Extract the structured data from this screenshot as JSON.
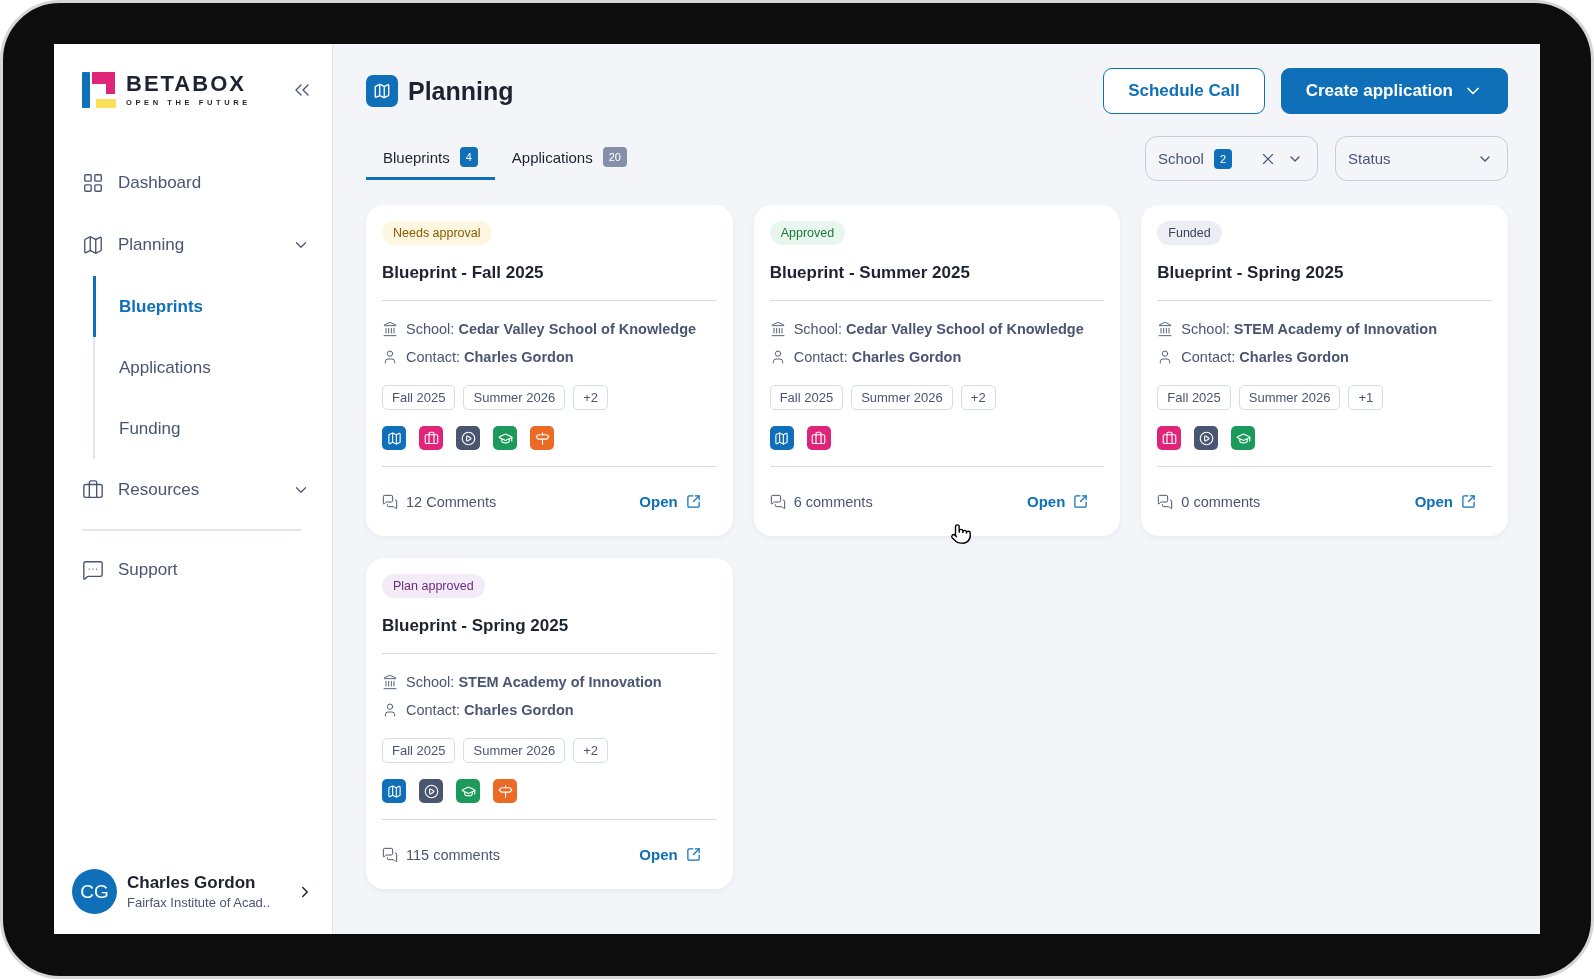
{
  "logo": {
    "name": "BETABOX",
    "tagline": "OPEN THE FUTURE"
  },
  "sidebar": {
    "items": [
      {
        "label": "Dashboard",
        "kind": "link",
        "selected": false
      },
      {
        "label": "Planning",
        "kind": "group",
        "selected": false,
        "expanded": true,
        "children": [
          {
            "label": "Blueprints",
            "selected": true
          },
          {
            "label": "Applications",
            "selected": false
          },
          {
            "label": "Funding",
            "selected": false
          }
        ]
      },
      {
        "label": "Resources",
        "kind": "group",
        "selected": false
      },
      {
        "label": "Support",
        "kind": "link",
        "selected": false
      }
    ],
    "user": {
      "initials": "CG",
      "name": "Charles Gordon",
      "org": "Fairfax Institute of Acad.."
    }
  },
  "header": {
    "title": "Planning",
    "buttons": [
      {
        "label": "Schedule Call",
        "kind": "outline"
      },
      {
        "label": "Create application",
        "kind": "primary"
      }
    ]
  },
  "tabs": [
    {
      "label": "Blueprints",
      "count": "4",
      "selected": true
    },
    {
      "label": "Applications",
      "count": "20",
      "selected": false
    }
  ],
  "filters": [
    {
      "label": "School",
      "count": "2",
      "clearable": true
    },
    {
      "label": "Status",
      "clearable": false
    }
  ],
  "cards": [
    {
      "status": {
        "label": "Needs approval",
        "kind": "warning"
      },
      "title": "Blueprint - Fall 2025",
      "school": "School: **Cedar Valley School of Knowledge**",
      "contact": "Contact: **Charles Gordon**",
      "tags": [
        "Fall 2025",
        "Summer 2026",
        "+2"
      ],
      "programs": [
        {
          "kind": "map",
          "color": "#0f6fb8"
        },
        {
          "kind": "briefcase",
          "color": "#e0247a"
        },
        {
          "kind": "play",
          "color": "#4a5572"
        },
        {
          "kind": "cap",
          "color": "#1c9a5c"
        },
        {
          "kind": "sign",
          "color": "#ea6a26"
        }
      ],
      "comments": "12 Comments",
      "action": "Open"
    },
    {
      "status": {
        "label": "Approved",
        "kind": "success"
      },
      "title": "Blueprint - Summer 2025",
      "school": "School: **Cedar Valley School of Knowledge**",
      "contact": "Contact: **Charles Gordon**",
      "tags": [
        "Fall 2025",
        "Summer 2026",
        "+2"
      ],
      "programs": [
        {
          "kind": "map",
          "color": "#0f6fb8"
        },
        {
          "kind": "briefcase",
          "color": "#e0247a"
        }
      ],
      "comments": "6 comments",
      "action": "Open"
    },
    {
      "status": {
        "label": "Funded",
        "kind": "neutral"
      },
      "title": "Blueprint - Spring 2025",
      "school": "School: **STEM Academy of Innovation**",
      "contact": "Contact: **Charles Gordon**",
      "tags": [
        "Fall 2025",
        "Summer 2026",
        "+1"
      ],
      "programs": [
        {
          "kind": "briefcase",
          "color": "#e0247a"
        },
        {
          "kind": "play",
          "color": "#4a5572"
        },
        {
          "kind": "cap",
          "color": "#1c9a5c"
        }
      ],
      "comments": "0 comments",
      "action": "Open"
    },
    {
      "status": {
        "label": "Plan approved",
        "kind": "purple"
      },
      "title": "Blueprint - Spring 2025",
      "school": "School: **STEM Academy of Innovation**",
      "contact": "Contact: **Charles Gordon**",
      "tags": [
        "Fall 2025",
        "Summer 2026",
        "+2"
      ],
      "programs": [
        {
          "kind": "map",
          "color": "#0f6fb8"
        },
        {
          "kind": "play",
          "color": "#4a5572"
        },
        {
          "kind": "cap",
          "color": "#1c9a5c"
        },
        {
          "kind": "sign",
          "color": "#ea6a26"
        }
      ],
      "comments": "115 comments",
      "action": "Open"
    }
  ]
}
